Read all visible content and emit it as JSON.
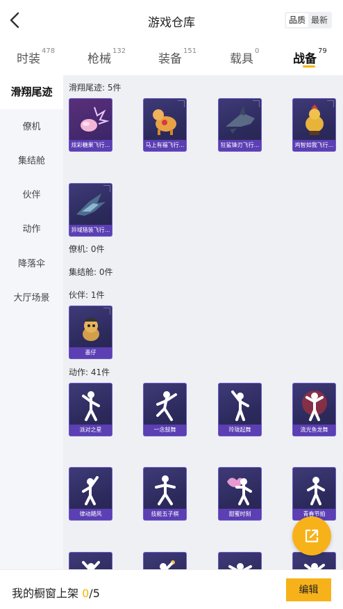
{
  "header": {
    "title": "游戏仓库",
    "sort_options": [
      "品质",
      "最新"
    ],
    "sort_active": "品质"
  },
  "tabs": [
    {
      "label": "时装",
      "count": "478"
    },
    {
      "label": "枪械",
      "count": "132"
    },
    {
      "label": "装备",
      "count": "151"
    },
    {
      "label": "载具",
      "count": "0"
    },
    {
      "label": "战备",
      "count": "79"
    }
  ],
  "active_tab": "战备",
  "sidebar": {
    "items": [
      "滑翔尾迹",
      "僚机",
      "集结舱",
      "伙伴",
      "动作",
      "降落伞",
      "大厅场景"
    ],
    "active": "滑翔尾迹"
  },
  "sections": {
    "glide": {
      "label": "滑翔尾迹: 5件",
      "items": [
        "炫彩糖果飞行...",
        "马上有福飞行...",
        "狂鲨锋刃飞行...",
        "鸡智如我飞行...",
        "异域猎装飞行..."
      ]
    },
    "wingman": {
      "label": "僚机: 0件"
    },
    "capsule": {
      "label": "集结舱: 0件"
    },
    "partner": {
      "label": "伙伴: 1件",
      "items": [
        "墨仔"
      ]
    },
    "emote": {
      "label": "动作: 41件",
      "items": [
        "派对之星",
        "一念鼓舞",
        "玲珑起舞",
        "流光鱼龙舞",
        "律动飓风",
        "技能五子棋",
        "甜蜜时刻",
        "青春节拍",
        "",
        "",
        "",
        ""
      ]
    }
  },
  "bottom": {
    "shelf_label": "我的橱窗上架",
    "shelf_current": "0",
    "shelf_total": "/5",
    "edit_label": "编辑"
  },
  "colors": {
    "accent": "#f7b21a",
    "card_border": "#6d5cc7",
    "card_caption": "#5b3fb3"
  }
}
